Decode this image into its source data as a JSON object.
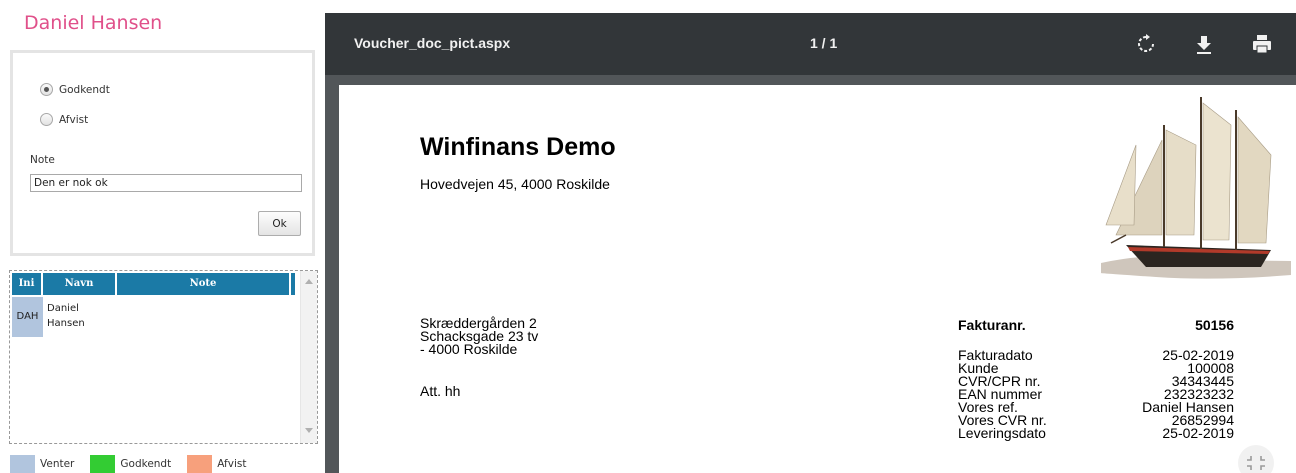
{
  "left_panel": {
    "user_name": "Daniel Hansen",
    "approval": {
      "option_approved": "Godkendt",
      "option_rejected": "Afvist",
      "selected": "Godkendt",
      "note_label": "Note",
      "note_value": "Den er nok ok",
      "ok_label": "Ok"
    },
    "table": {
      "headers": [
        "Ini",
        "Navn",
        "Note"
      ],
      "rows": [
        {
          "ini": "DAH",
          "navn_first": "Daniel",
          "navn_last": "Hansen",
          "note": ""
        }
      ]
    },
    "legend": [
      {
        "label": "Venter",
        "color": "#b1c5de"
      },
      {
        "label": "Godkendt",
        "color": "#33cc33"
      },
      {
        "label": "Afvist",
        "color": "#f7a07c"
      }
    ]
  },
  "viewer": {
    "file_name": "Voucher_doc_pict.aspx",
    "page_indicator": "1 / 1",
    "toolbar_icons": [
      "rotate-icon",
      "download-icon",
      "print-icon"
    ],
    "document": {
      "company_name": "Winfinans Demo",
      "company_address": "Hovedvejen 45, 4000 Roskilde",
      "recipient_lines": [
        "Skræddergården 2",
        "Schacksgade 23 tv",
        "- 4000 Roskilde"
      ],
      "attention": "Att. hh",
      "invoice_label": "Fakturanr.",
      "invoice_number": "50156",
      "details": [
        {
          "label": "Fakturadato",
          "value": "25-02-2019"
        },
        {
          "label": "Kunde",
          "value": "100008"
        },
        {
          "label": "CVR/CPR nr.",
          "value": "34343445"
        },
        {
          "label": "EAN nummer",
          "value": "232323232"
        },
        {
          "label": "Vores ref.",
          "value": "Daniel Hansen"
        },
        {
          "label": "Vores CVR nr.",
          "value": "26852994"
        },
        {
          "label": "Leveringsdato",
          "value": "25-02-2019"
        }
      ]
    }
  },
  "colors": {
    "title_pink": "#e0508a",
    "table_header_blue": "#1b7aa6",
    "viewer_toolbar": "#323639",
    "viewer_background": "#525659"
  }
}
